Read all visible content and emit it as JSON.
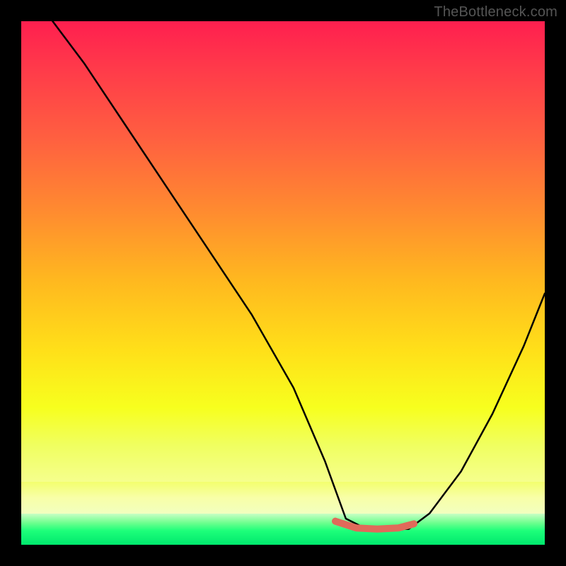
{
  "watermark": "TheBottleneck.com",
  "chart_data": {
    "type": "line",
    "title": "",
    "xlabel": "",
    "ylabel": "",
    "xlim": [
      0,
      100
    ],
    "ylim": [
      0,
      100
    ],
    "grid": false,
    "legend": false,
    "note": "Bottleneck-style curve: steep descent from upper left, flat minimum around x≈62–74 with a small red marker segment at the minimum, then rises toward the right. Background is a vertical heat gradient (red top → yellow middle → green bottom).",
    "series": [
      {
        "name": "curve",
        "color": "#000000",
        "x": [
          6,
          12,
          20,
          28,
          36,
          44,
          52,
          58,
          62,
          66,
          70,
          74,
          78,
          84,
          90,
          96,
          100
        ],
        "values": [
          100,
          92,
          80,
          68,
          56,
          44,
          30,
          16,
          5,
          3,
          3,
          3,
          6,
          14,
          25,
          38,
          48
        ]
      },
      {
        "name": "min-highlight",
        "color": "#e06a5a",
        "x": [
          60,
          64,
          68,
          72,
          75
        ],
        "values": [
          4.5,
          3.2,
          3.0,
          3.2,
          4.0
        ]
      }
    ]
  }
}
